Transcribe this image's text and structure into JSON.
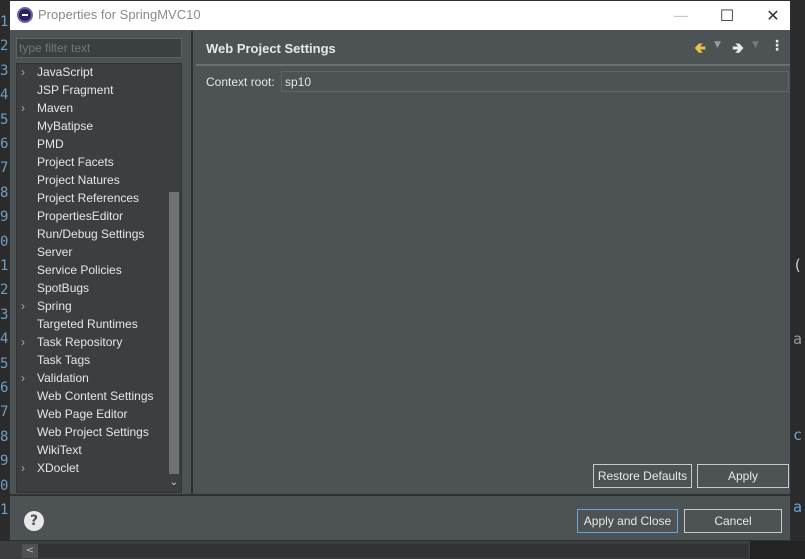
{
  "window": {
    "title": "Properties for SpringMVC10"
  },
  "filter": {
    "placeholder": "type filter text"
  },
  "tree": {
    "items": [
      {
        "label": "JavaScript",
        "expandable": true
      },
      {
        "label": "JSP Fragment",
        "expandable": false
      },
      {
        "label": "Maven",
        "expandable": true
      },
      {
        "label": "MyBatipse",
        "expandable": false
      },
      {
        "label": "PMD",
        "expandable": false
      },
      {
        "label": "Project Facets",
        "expandable": false
      },
      {
        "label": "Project Natures",
        "expandable": false
      },
      {
        "label": "Project References",
        "expandable": false
      },
      {
        "label": "PropertiesEditor",
        "expandable": false
      },
      {
        "label": "Run/Debug Settings",
        "expandable": false
      },
      {
        "label": "Server",
        "expandable": false
      },
      {
        "label": "Service Policies",
        "expandable": false
      },
      {
        "label": "SpotBugs",
        "expandable": false
      },
      {
        "label": "Spring",
        "expandable": true
      },
      {
        "label": "Targeted Runtimes",
        "expandable": false
      },
      {
        "label": "Task Repository",
        "expandable": true
      },
      {
        "label": "Task Tags",
        "expandable": false
      },
      {
        "label": "Validation",
        "expandable": true
      },
      {
        "label": "Web Content Settings",
        "expandable": false
      },
      {
        "label": "Web Page Editor",
        "expandable": false
      },
      {
        "label": "Web Project Settings",
        "expandable": false
      },
      {
        "label": "WikiText",
        "expandable": false
      },
      {
        "label": "XDoclet",
        "expandable": true
      }
    ]
  },
  "page": {
    "title": "Web Project Settings",
    "context_root_label": "Context root:",
    "context_root_value": "sp10",
    "restore_defaults": "Restore Defaults",
    "apply": "Apply"
  },
  "footer": {
    "apply_and_close": "Apply and Close",
    "cancel": "Cancel"
  },
  "background": {
    "gutter": [
      "1",
      "2",
      "3",
      "4",
      "5",
      "6",
      "7",
      "8",
      "9",
      "0",
      "1",
      "2",
      "3",
      "4",
      "5",
      "6",
      "7",
      "8",
      "9",
      "0",
      "1"
    ],
    "right_chars": [
      "(",
      "a",
      "c",
      "a"
    ]
  },
  "colors": {
    "dialog_bg": "#4d5254",
    "accent": "#6aa4d8",
    "back_arrow": "#e8c24a"
  }
}
